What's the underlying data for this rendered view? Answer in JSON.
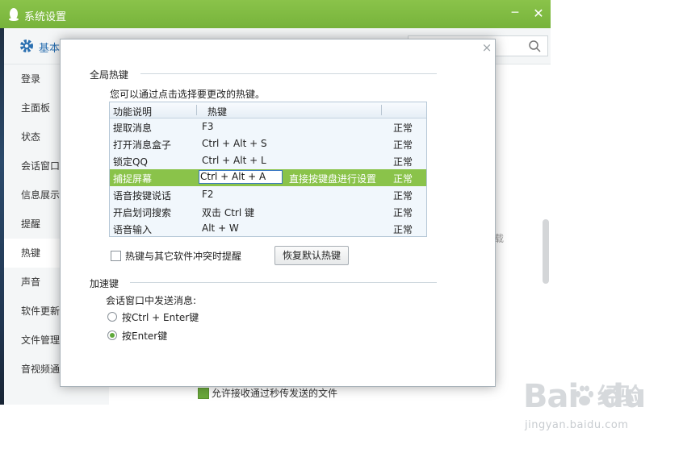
{
  "window": {
    "title": "系统设置",
    "minimize": "─",
    "close": "✕"
  },
  "toolbar": {
    "tab_basic": "基本"
  },
  "sidebar": {
    "items": [
      {
        "label": "登录"
      },
      {
        "label": "主面板"
      },
      {
        "label": "状态"
      },
      {
        "label": "会话窗口"
      },
      {
        "label": "信息展示"
      },
      {
        "label": "提醒"
      },
      {
        "label": "热键"
      },
      {
        "label": "声音"
      },
      {
        "label": "软件更新"
      },
      {
        "label": "文件管理"
      },
      {
        "label": "音视频通"
      }
    ]
  },
  "background": {
    "fragment": "载",
    "checkbox_label": "允许接收通过秒传发送的文件"
  },
  "dialog": {
    "close": "×",
    "global_hotkeys_title": "全局热键",
    "description": "您可以通过点击选择要更改的热键。",
    "table": {
      "headers": {
        "function": "功能说明",
        "hotkey": "热键"
      },
      "rows": [
        {
          "function": "提取消息",
          "hotkey": "F3",
          "status": "正常"
        },
        {
          "function": "打开消息盒子",
          "hotkey": "Ctrl + Alt + S",
          "status": "正常"
        },
        {
          "function": "锁定QQ",
          "hotkey": "Ctrl + Alt + L",
          "status": "正常"
        },
        {
          "function": "捕捉屏幕",
          "hotkey": "Ctrl + Alt + A",
          "hint": "直接按键盘进行设置",
          "status": "正常"
        },
        {
          "function": "语音按键说话",
          "hotkey": "F2",
          "status": "正常"
        },
        {
          "function": "开启划词搜索",
          "hotkey": "双击 Ctrl 键",
          "status": "正常"
        },
        {
          "function": "语音输入",
          "hotkey": "Alt + W",
          "status": "正常"
        }
      ]
    },
    "conflict_checkbox": "热键与其它软件冲突时提醒",
    "restore_button": "恢复默认热键",
    "accel_title": "加速键",
    "send_label": "会话窗口中发送消息:",
    "option_ctrl_enter": "按Ctrl + Enter键",
    "option_enter": "按Enter键"
  },
  "watermark": {
    "brand": "Bai",
    "brand2": "du",
    "cn": "经验",
    "url": "jingyan.baidu.com"
  },
  "colors": {
    "accent": "#8ac34a",
    "link": "#2a6fb0"
  }
}
